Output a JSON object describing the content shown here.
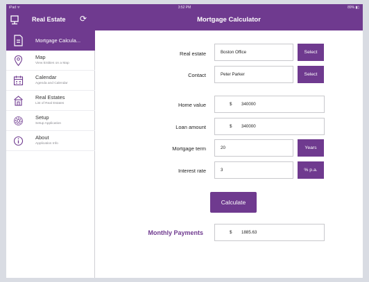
{
  "status": {
    "carrier": "iPad ᯤ",
    "time": "3:52 PM",
    "battery": "89% ▮▯"
  },
  "app": {
    "title": "Real Estate"
  },
  "page": {
    "title": "Mortgage Calculator"
  },
  "sidebar": {
    "items": [
      {
        "label": "Mortgage Calcula...",
        "sub": "",
        "icon": "calculator-icon"
      },
      {
        "label": "Map",
        "sub": "View Entities on a Map",
        "icon": "map-pin-icon"
      },
      {
        "label": "Calendar",
        "sub": "Agenda and Calendar",
        "icon": "calendar-icon"
      },
      {
        "label": "Real Estates",
        "sub": "List of Real Estates",
        "icon": "building-icon"
      },
      {
        "label": "Setup",
        "sub": "Setup Application",
        "icon": "gear-icon"
      },
      {
        "label": "About",
        "sub": "Application Info",
        "icon": "info-icon"
      }
    ]
  },
  "form": {
    "real_estate": {
      "label": "Real estate",
      "value": "Boston Office",
      "action": "Select"
    },
    "contact": {
      "label": "Contact",
      "value": "Peter Parker",
      "action": "Select"
    },
    "home_value": {
      "label": "Home value",
      "currency": "$",
      "value": "340000"
    },
    "loan_amount": {
      "label": "Loan amount",
      "currency": "$",
      "value": "340000"
    },
    "mortgage_term": {
      "label": "Mortgage term",
      "value": "20",
      "unit": "Years"
    },
    "interest_rate": {
      "label": "Interest rate",
      "value": "3",
      "unit": "% p.a."
    },
    "calculate_label": "Calculate",
    "monthly": {
      "label": "Monthly Payments",
      "currency": "$",
      "value": "1885.63"
    }
  },
  "colors": {
    "accent": "#6f3a8f",
    "background": "#d9dce3",
    "field_border": "#c8c8cc"
  }
}
